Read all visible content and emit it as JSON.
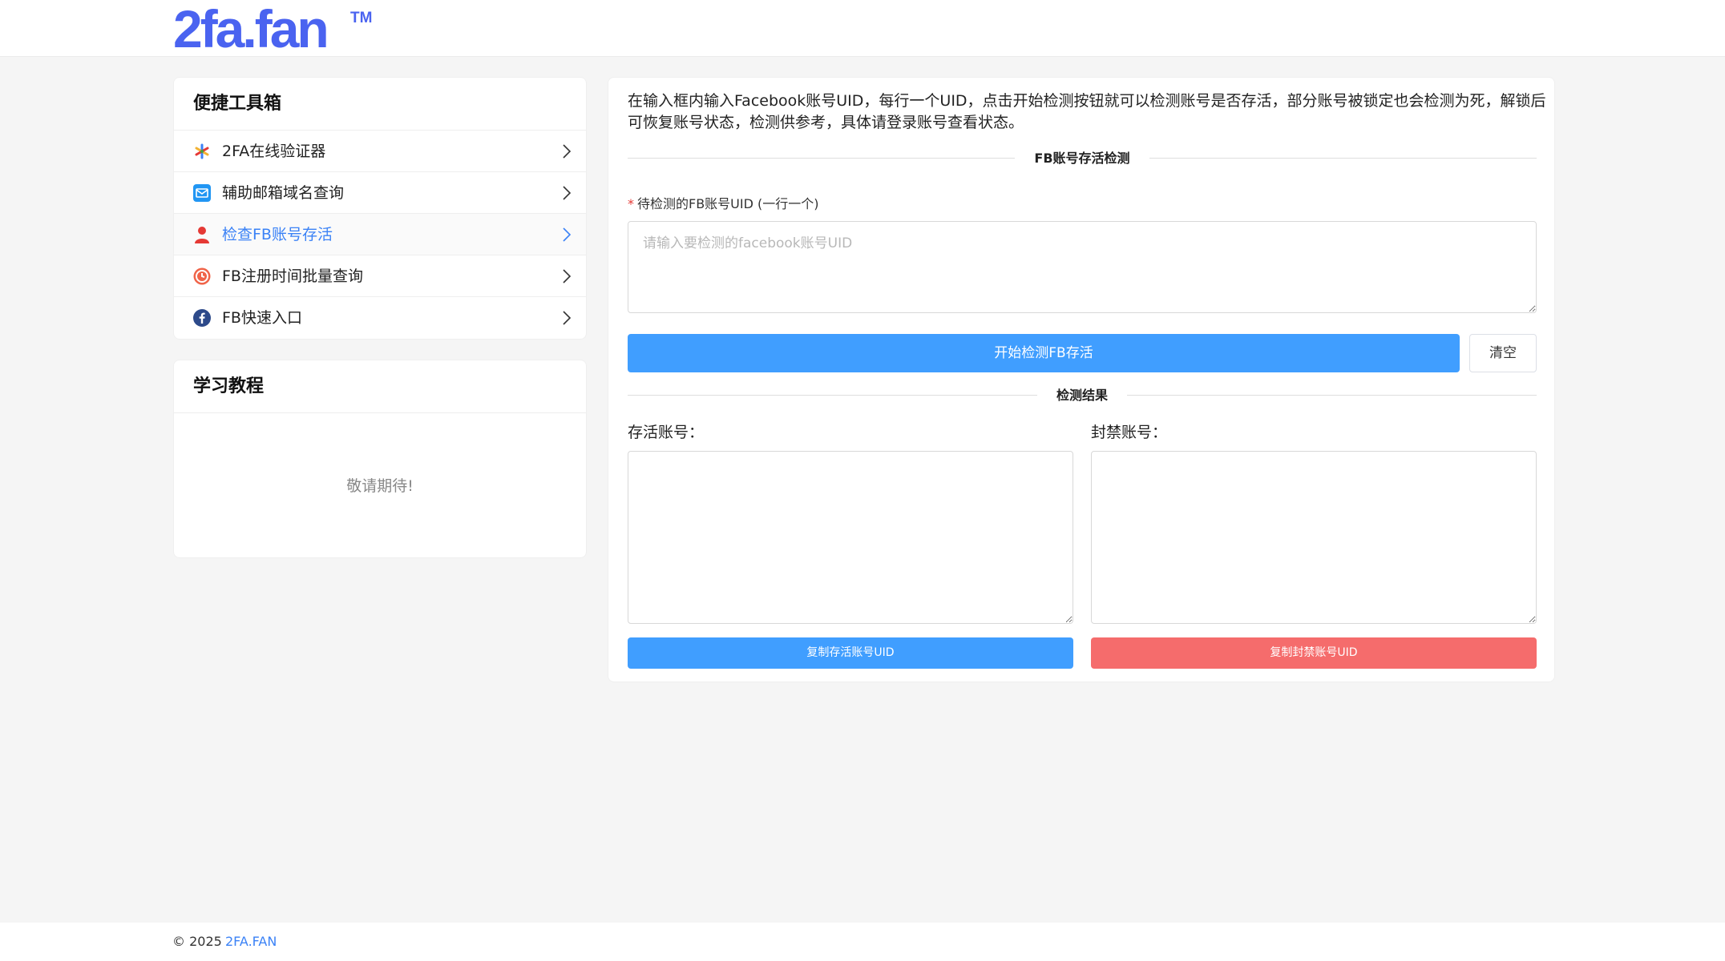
{
  "header": {
    "logo_text": "2fa.fan",
    "logo_tm": "TM",
    "brand_color": "#4a63f0"
  },
  "sidebar": {
    "toolbox_title": "便捷工具箱",
    "items": [
      {
        "label": "2FA在线验证器",
        "icon": "asterisk-icon"
      },
      {
        "label": "辅助邮箱域名查询",
        "icon": "mail-icon"
      },
      {
        "label": "检查FB账号存活",
        "icon": "user-icon",
        "active": true
      },
      {
        "label": "FB注册时间批量查询",
        "icon": "clock-icon"
      },
      {
        "label": "FB快速入口",
        "icon": "facebook-icon"
      }
    ],
    "tutorial_title": "学习教程",
    "tutorial_empty": "敬请期待!"
  },
  "main": {
    "description": "在输入框内输入Facebook账号UID，每行一个UID，点击开始检测按钮就可以检测账号是否存活，部分账号被锁定也会检测为死，解锁后可恢复账号状态，检测供参考，具体请登录账号查看状态。",
    "section_title": "FB账号存活检测",
    "uid_label": "待检测的FB账号UID (一行一个)",
    "uid_placeholder": "请输入要检测的facebook账号UID",
    "start_button": "开始检测FB存活",
    "clear_button": "清空",
    "result_title": "检测结果",
    "alive_label": "存活账号：",
    "banned_label": "封禁账号：",
    "copy_alive_button": "复制存活账号UID",
    "copy_banned_button": "复制封禁账号UID"
  },
  "footer": {
    "copyright": "© 2025",
    "brand": "2FA.FAN"
  },
  "colors": {
    "primary": "#409eff",
    "danger": "#f56c6c",
    "active": "#3b82f6"
  }
}
